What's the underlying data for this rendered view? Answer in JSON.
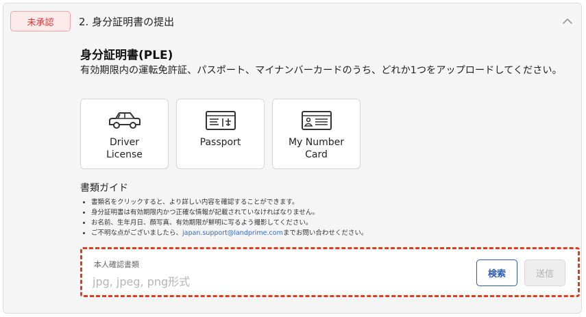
{
  "header": {
    "status_badge": "未承認",
    "section_title": "2. 身分証明書の提出",
    "collapse_icon": "chevron-up-icon"
  },
  "content": {
    "heading": "身分証明書(PLE)",
    "description": "有効期限内の運転免許証、パスポート、マイナンバーカードのうち、どれか1つをアップロードしてください。"
  },
  "documents": [
    {
      "label": "Driver License",
      "icon": "car-icon"
    },
    {
      "label": "Passport",
      "icon": "passport-icon"
    },
    {
      "label": "My Number Card",
      "icon": "id-card-icon"
    }
  ],
  "guide": {
    "title": "書類ガイド",
    "items": [
      "書類名をクリックすると、より詳しい内容を確認することができます。",
      "身分証明書は有効期限内かつ正確な情報が記載されていなければなりません。",
      "お名前、生年月日、顔写真、有効期限が鮮明に写るよう撮影してください。"
    ],
    "contact_prefix": "ご不明な点がございましたら、",
    "contact_email": "japan.support@landprime.com",
    "contact_suffix": "までお問い合わせください。"
  },
  "upload": {
    "label": "本人確認書類",
    "placeholder": "jpg, jpeg, png形式",
    "value": "",
    "search_button": "検索",
    "send_button": "送信"
  },
  "colors": {
    "badge_text": "#e03131",
    "badge_bg": "#fdeaea",
    "accent_blue": "#2a5bb8",
    "link_blue": "#2f6cd8",
    "dashed_highlight": "#e23b1c"
  }
}
